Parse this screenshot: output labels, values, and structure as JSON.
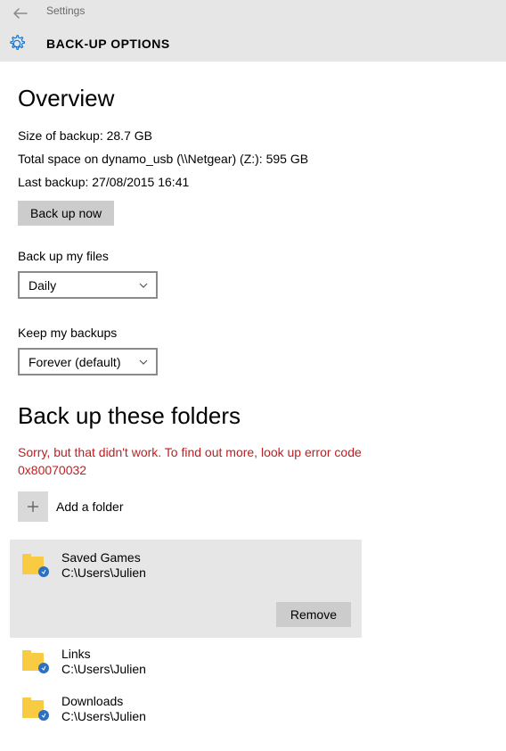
{
  "header": {
    "settings_label": "Settings",
    "page_title": "BACK-UP OPTIONS"
  },
  "overview": {
    "heading": "Overview",
    "size_label": "Size of backup: 28.7 GB",
    "total_space_label": "Total space on dynamo_usb (\\\\Netgear) (Z:): 595 GB",
    "last_backup_label": "Last backup: 27/08/2015 16:41",
    "backup_now_label": "Back up now"
  },
  "schedule": {
    "backup_files_label": "Back up my files",
    "backup_files_value": "Daily",
    "keep_backups_label": "Keep my backups",
    "keep_backups_value": "Forever (default)"
  },
  "folders": {
    "heading": "Back up these folders",
    "error": "Sorry, but that didn't work. To find out more, look up error code 0x80070032",
    "add_label": "Add a folder",
    "remove_label": "Remove",
    "items": [
      {
        "name": "Saved Games",
        "path": "C:\\Users\\Julien"
      },
      {
        "name": "Links",
        "path": "C:\\Users\\Julien"
      },
      {
        "name": "Downloads",
        "path": "C:\\Users\\Julien"
      }
    ]
  }
}
